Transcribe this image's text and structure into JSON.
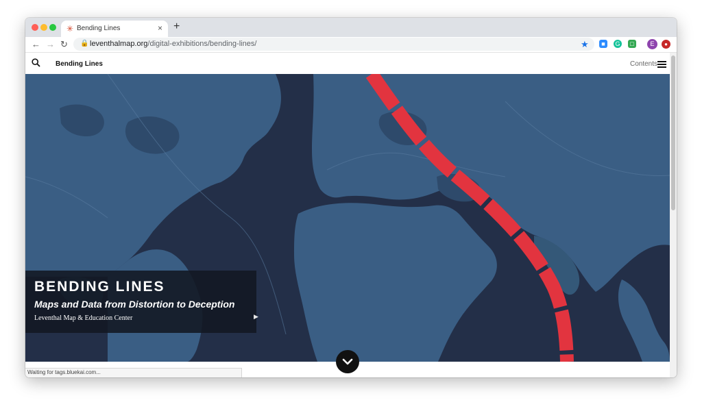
{
  "browser": {
    "tab_title": "Bending Lines",
    "tab_close": "×",
    "new_tab": "+",
    "url_domain": "leventhalmap.org",
    "url_path": "/digital-exhibitions/bending-lines/",
    "profile_initial": "E",
    "status_text": "Waiting for tags.bluekai.com..."
  },
  "site": {
    "brand": "Bending Lines",
    "contents_label": "Contents"
  },
  "hero": {
    "title": "BENDING LINES",
    "subtitle": "Maps and Data from Distortion to Deception",
    "org": "Leventhal Map & Education Center"
  },
  "colors": {
    "accent_red": "#e2343f",
    "ocean": "#232f48",
    "land": "#3a5e84"
  },
  "icons": {
    "search": "search-icon",
    "menu": "menu-icon",
    "scroll_down": "chevron-down-icon"
  }
}
